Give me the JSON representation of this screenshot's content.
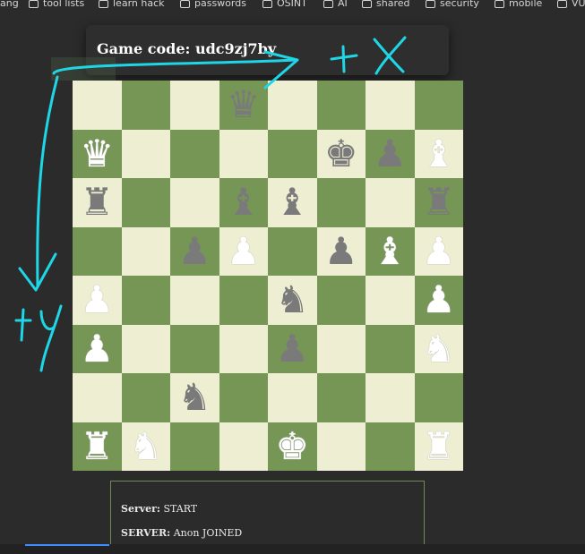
{
  "bookmarks": [
    {
      "label": "ang",
      "icon": "none"
    },
    {
      "label": "tool lists",
      "icon": "folder-icon"
    },
    {
      "label": "learn hack",
      "icon": "folder-icon"
    },
    {
      "label": "passwords",
      "icon": "folder-icon"
    },
    {
      "label": "OSINT",
      "icon": "folder-icon"
    },
    {
      "label": "AI",
      "icon": "folder-icon"
    },
    {
      "label": "shared",
      "icon": "folder-icon"
    },
    {
      "label": "security",
      "icon": "folder-icon"
    },
    {
      "label": "mobile",
      "icon": "folder-icon"
    },
    {
      "label": "VU",
      "icon": "folder-icon"
    }
  ],
  "game": {
    "code_label": "Game code: udc9zj7by"
  },
  "board": {
    "light_color": "#eeeed2",
    "dark_color": "#769656",
    "rows": [
      [
        "",
        "",
        "",
        "bq",
        "",
        "",
        "",
        ""
      ],
      [
        "wq",
        "",
        "",
        "",
        "",
        "bk",
        "bp",
        "wb"
      ],
      [
        "br",
        "",
        "",
        "bb",
        "bb",
        "",
        "",
        "br"
      ],
      [
        "",
        "",
        "bp",
        "wp",
        "",
        "bp",
        "wb",
        "wp"
      ],
      [
        "wp",
        "",
        "",
        "",
        "bn",
        "",
        "",
        "wp"
      ],
      [
        "wp",
        "",
        "",
        "",
        "bp",
        "",
        "",
        "wn"
      ],
      [
        "",
        "",
        "bn",
        "",
        "",
        "",
        "",
        ""
      ],
      [
        "wr",
        "wn",
        "",
        "",
        "wk",
        "",
        "",
        "wr"
      ]
    ]
  },
  "log": [
    {
      "source": "Server:",
      "message": "START"
    },
    {
      "source": "SERVER:",
      "message": "Anon JOINED"
    }
  ],
  "annotations": {
    "x_label": "+X",
    "y_label": "+y",
    "color": "#1fd6e6"
  }
}
